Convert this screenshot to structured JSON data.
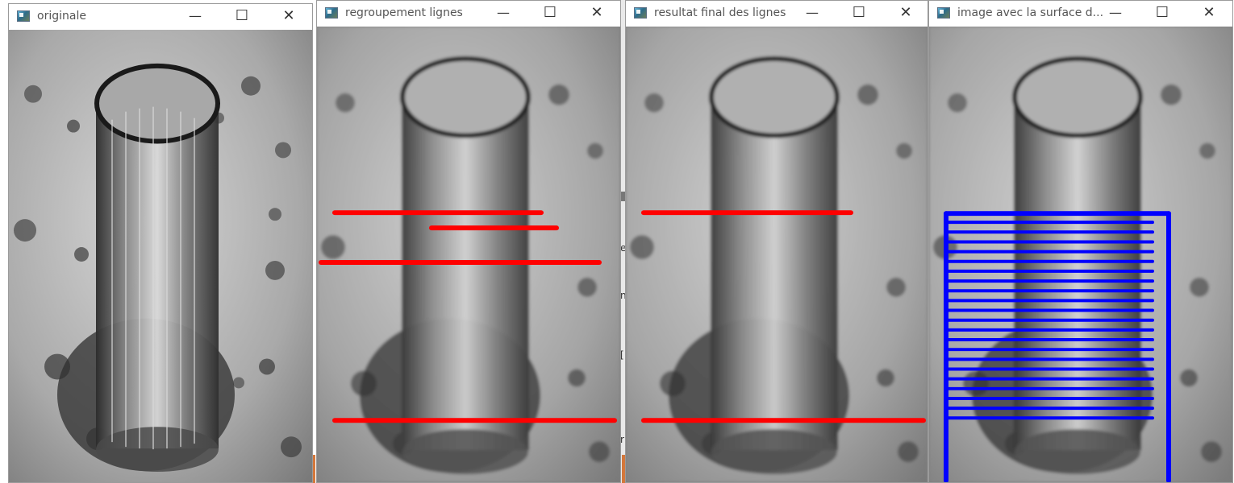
{
  "desktop": {
    "colors": {
      "line_red": "#ff0000",
      "line_blue": "#0000ff",
      "photo_light": "#c8c8c8",
      "photo_dark": "#2e2e2e"
    },
    "background_glyphs": [
      "e",
      "n",
      "[",
      "r"
    ]
  },
  "windows": [
    {
      "title": "originale",
      "controls": {
        "minimize": "—",
        "maximize": "☐",
        "close": "✕"
      },
      "image_icon": "app-icon"
    },
    {
      "title": "regroupement lignes",
      "controls": {
        "minimize": "—",
        "maximize": "☐",
        "close": "✕"
      },
      "image_icon": "app-icon"
    },
    {
      "title": "resultat final des lignes",
      "controls": {
        "minimize": "—",
        "maximize": "☐",
        "close": "✕"
      },
      "image_icon": "app-icon"
    },
    {
      "title": "image avec la surface d...",
      "controls": {
        "minimize": "—",
        "maximize": "☐",
        "close": "✕"
      },
      "image_icon": "app-icon"
    }
  ]
}
